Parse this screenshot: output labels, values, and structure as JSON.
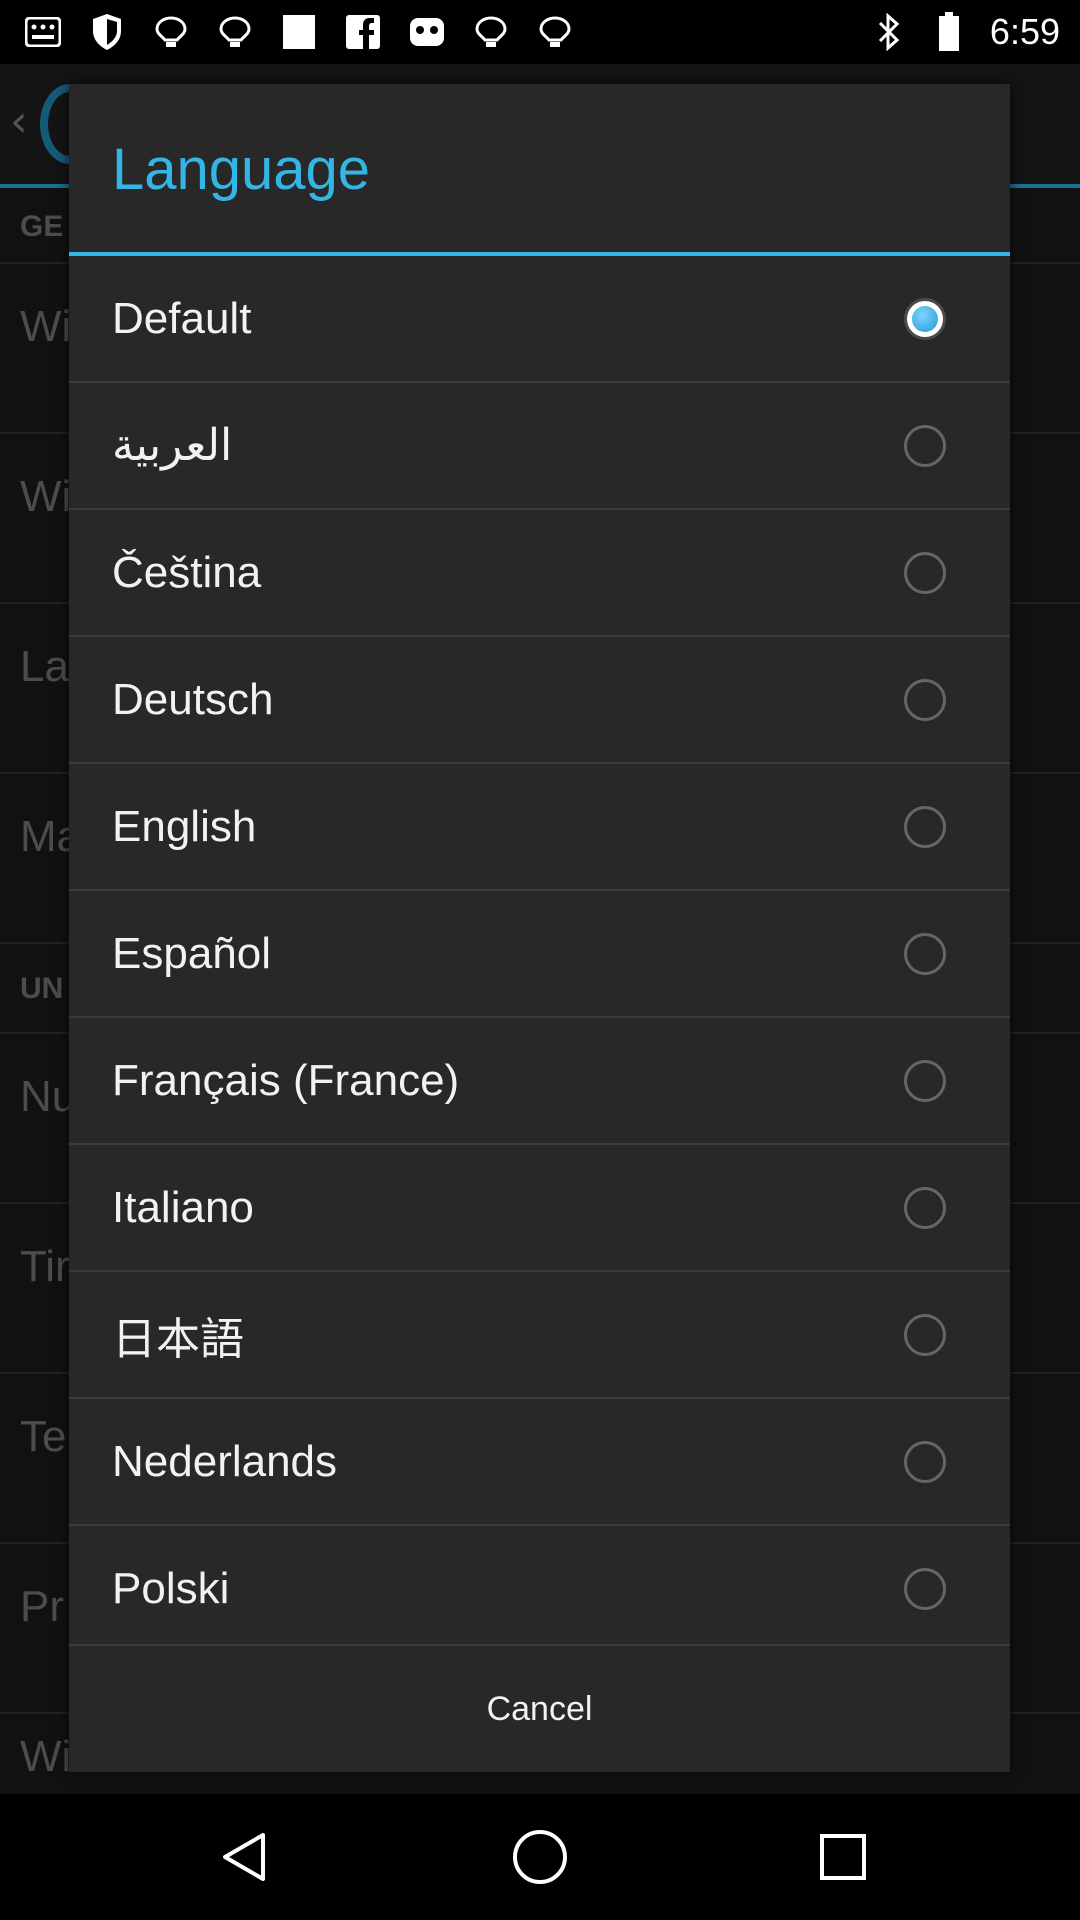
{
  "status_bar": {
    "time": "6:59",
    "icons": [
      "notification-icon",
      "shield-icon",
      "wifi-icon",
      "wifi-icon",
      "image-icon",
      "facebook-icon",
      "game-controller-icon",
      "wifi-icon",
      "wifi-icon",
      "bluetooth-icon",
      "battery-icon"
    ]
  },
  "dialog": {
    "title": "Language",
    "items": [
      {
        "label": "Default",
        "selected": true
      },
      {
        "label": "العربية",
        "selected": false
      },
      {
        "label": "Čeština",
        "selected": false
      },
      {
        "label": "Deutsch",
        "selected": false
      },
      {
        "label": "English",
        "selected": false
      },
      {
        "label": "Español",
        "selected": false
      },
      {
        "label": "Français (France)",
        "selected": false
      },
      {
        "label": "Italiano",
        "selected": false
      },
      {
        "label": "日本語",
        "selected": false
      },
      {
        "label": "Nederlands",
        "selected": false
      },
      {
        "label": "Polski",
        "selected": false
      }
    ],
    "cancel_label": "Cancel"
  },
  "background": {
    "rows": [
      "GE",
      "Wi",
      "Wi",
      "La",
      "Ma",
      "UN",
      "Nu",
      "Tir",
      "Te",
      "Pr",
      "Wind"
    ]
  },
  "colors": {
    "accent": "#33b5e5",
    "dialog_bg": "#282828",
    "divider": "#3b3b3b"
  },
  "nav_bar": {
    "buttons": [
      "back-icon",
      "home-icon",
      "recents-icon"
    ]
  }
}
